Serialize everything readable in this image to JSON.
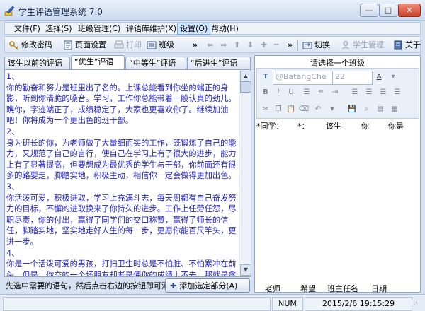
{
  "window": {
    "title": "学生评语管理系统 7.0",
    "min": "—",
    "max": "□",
    "close": "✕"
  },
  "menu": [
    {
      "label": "文件(F)"
    },
    {
      "label": "选择(S)"
    },
    {
      "label": "班级管理(C)"
    },
    {
      "label": "评语库维护(X)"
    },
    {
      "label": "设置(O)"
    },
    {
      "label": "帮助(H)"
    }
  ],
  "toolbar": {
    "edit_password": "修改密码",
    "page_setup": "页面设置",
    "print": "打印",
    "class": "班级",
    "more": "»",
    "switch": "切换",
    "student_mgmt": "学生管理",
    "about": "关于"
  },
  "tabs": [
    "该生以前的评语",
    "“优生”评语",
    "“中等生”评语",
    "“后进生”评语"
  ],
  "comments": [
    {
      "num": "1、",
      "text": "你的勤奋和努力是班里出了名的。上课总能看到你坐的端正的身影，听到你清脆的嗓音。学习，工作你总能带着一股认真的劲儿。瞧你，字迹端正了，成绩稳定了，大家也更喜欢你了。继续加油吧！你将成为一个更出色的班干部。"
    },
    {
      "num": "2、",
      "text": "身为班长的你，为老师做了大量细而实的工作，既锻炼了自己的能力，又规范了自己的言行，使自己在学习上有了很大的进步，能力上有了显著提高，但要想成为最优秀的学生与干部，你前面还有很多的路要走，脚踏实地，积极主动，相信你一定会做得更加出色。"
    },
    {
      "num": "3、",
      "text": "你活泼可爱，积极进取，学习上充满斗志，每天周都有自己奋发努力的目标，不懈的进取换来了你持久的进步。工作上任劳任怨，尽职尽责，你的付出，赢得了同学们的交口称赞，赢得了师长的信任，脚踏实地，坚实地走好人生的每一步，更愿你能百尺竿头，更进一步。"
    },
    {
      "num": "4、",
      "text": "你是一个活泼可爱的男孩，打扫卫生时总是不怕脏、不怕累冲在前头。但是，你交的一个坏朋友却老是使你的成绩上不去，那就是贪玩。假如你能丢掉这个坏朋友，再交上个好朋友：认真学习、认真听讲，按时完成作业，那么，下一个学期的中队委，你就当之无愧了！"
    }
  ],
  "hint": "先选中需要的语句，然后点击右边的按钮即可添加到评语中。",
  "add_button": "添加选定部分(A)",
  "right": {
    "prompt": "请选择一个班级",
    "font": "@BatangChe",
    "size": "22",
    "columns": [
      "*同学：",
      "*：",
      "该生",
      "你",
      "你是"
    ],
    "footer": [
      "老师",
      "希望",
      "班主任名",
      "日期"
    ]
  },
  "status": {
    "num": "NUM",
    "datetime": "2015/2/6  19:15:29"
  }
}
